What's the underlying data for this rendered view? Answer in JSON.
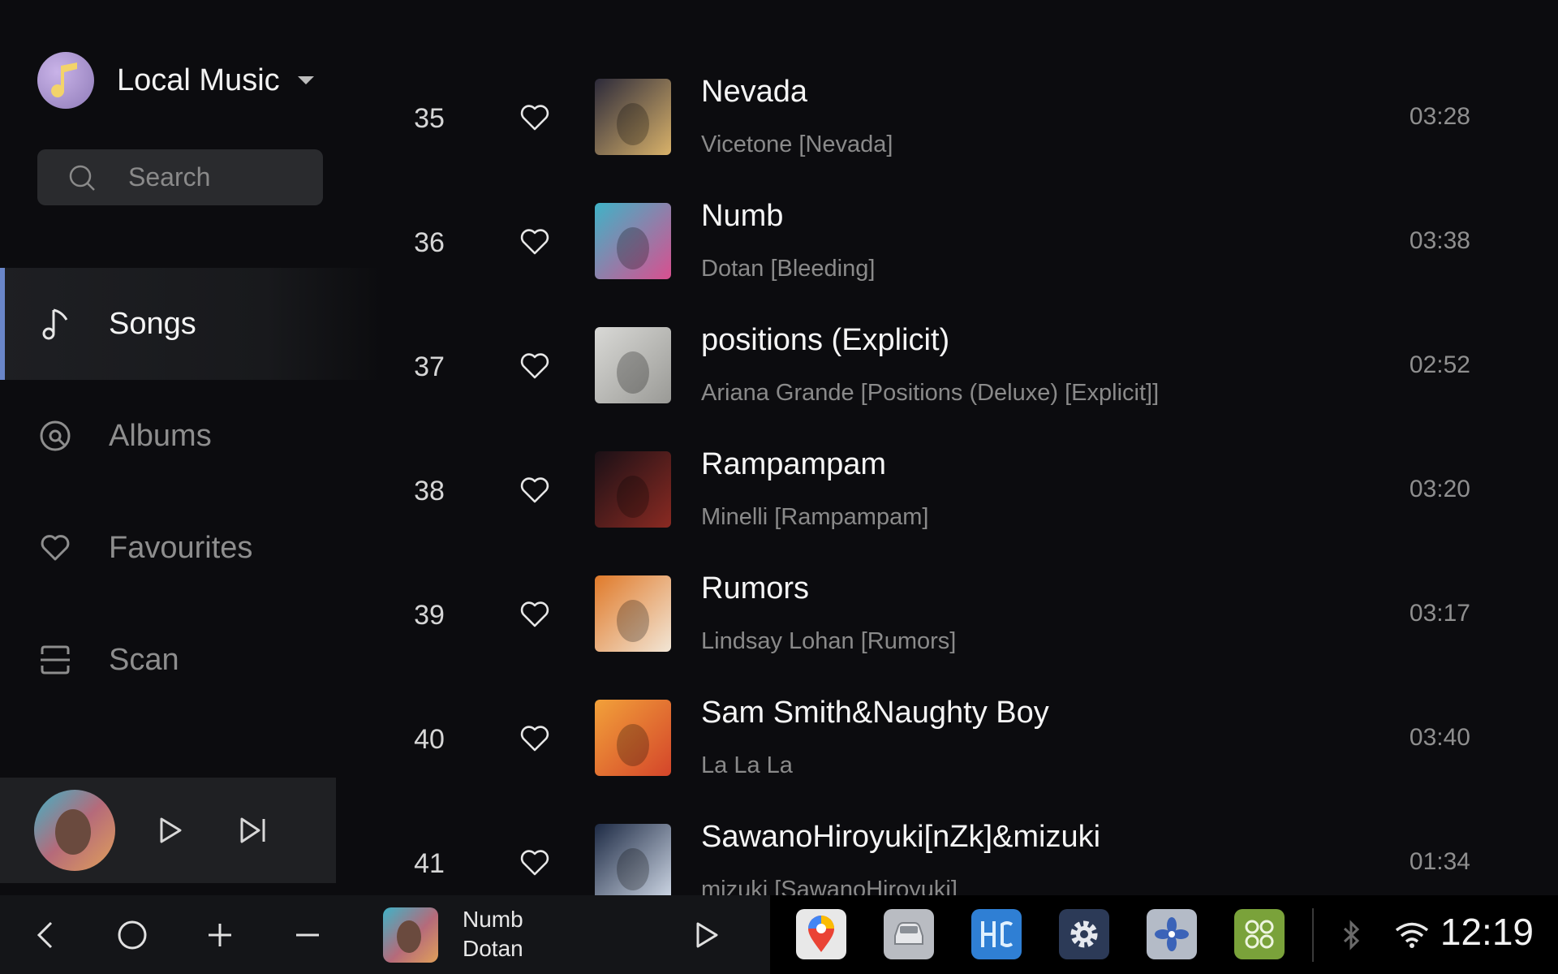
{
  "sidebar": {
    "source": {
      "label": "Local Music",
      "icon": "music-note-icon"
    },
    "search": {
      "placeholder": "Search"
    },
    "nav": [
      {
        "label": "Songs",
        "icon": "music-note-icon",
        "active": true
      },
      {
        "label": "Albums",
        "icon": "disc-icon",
        "active": false
      },
      {
        "label": "Favourites",
        "icon": "heart-icon",
        "active": false
      },
      {
        "label": "Scan",
        "icon": "scan-icon",
        "active": false
      }
    ]
  },
  "songs": [
    {
      "index": "35",
      "title": "Nevada",
      "subtitle": "Vicetone [Nevada]",
      "duration": "03:28",
      "art_colors": [
        "#2c2a3a",
        "#d9b26a"
      ]
    },
    {
      "index": "36",
      "title": "Numb",
      "subtitle": "Dotan [Bleeding]",
      "duration": "03:38",
      "art_colors": [
        "#3fb3c7",
        "#d94f8f"
      ]
    },
    {
      "index": "37",
      "title": "positions (Explicit)",
      "subtitle": "Ariana Grande [Positions (Deluxe) [Explicit]]",
      "duration": "02:52",
      "art_colors": [
        "#d9d9d6",
        "#9a9a96"
      ]
    },
    {
      "index": "38",
      "title": "Rampampam",
      "subtitle": "Minelli [Rampampam]",
      "duration": "03:20",
      "art_colors": [
        "#1a1016",
        "#8a2a22"
      ]
    },
    {
      "index": "39",
      "title": "Rumors",
      "subtitle": "Lindsay Lohan [Rumors]",
      "duration": "03:17",
      "art_colors": [
        "#e07a2a",
        "#f2e6d6"
      ]
    },
    {
      "index": "40",
      "title": "Sam Smith&Naughty Boy",
      "subtitle": "La La La",
      "duration": "03:40",
      "art_colors": [
        "#f2a13a",
        "#d4452a"
      ]
    },
    {
      "index": "41",
      "title": "SawanoHiroyuki[nZk]&mizuki",
      "subtitle": "mizuki [SawanoHiroyuki]",
      "duration": "01:34",
      "art_colors": [
        "#1d2a44",
        "#cfd8e6"
      ]
    }
  ],
  "mini_player": {
    "cover_icon": "album-cover-icon"
  },
  "system_bar": {
    "now_playing_title": "Numb",
    "now_playing_artist": "Dotan",
    "clock": "12:19",
    "apps": [
      "maps-icon",
      "car-icon",
      "hc-app-icon",
      "settings-icon",
      "fan-icon",
      "apps-grid-icon"
    ]
  },
  "colors": {
    "accent": "#6a86c9",
    "background": "#0c0c0f",
    "muted_text": "#8a8a8a"
  }
}
